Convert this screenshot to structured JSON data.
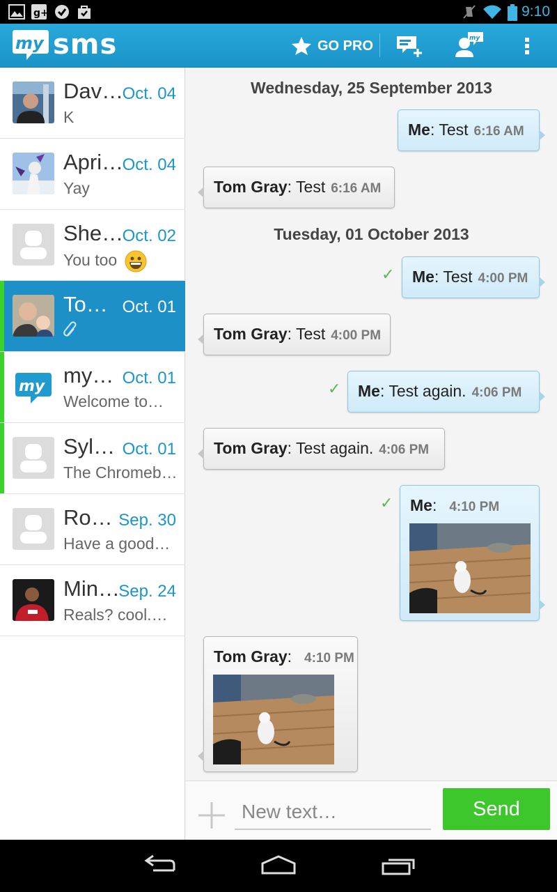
{
  "status_bar": {
    "time": "9:10"
  },
  "action_bar": {
    "logo_text": "sms",
    "logo_bubble_text": "my",
    "go_pro_label": "GO PRO"
  },
  "conversations": [
    {
      "name": "Dav…",
      "date": "Oct. 04",
      "preview": "K",
      "unread": false,
      "active": false
    },
    {
      "name": "Apri…",
      "date": "Oct. 04",
      "preview": "Yay",
      "unread": false,
      "active": false
    },
    {
      "name": "She…",
      "date": "Oct. 02",
      "preview": "You too",
      "unread": false,
      "active": false
    },
    {
      "name": "To…",
      "date": "Oct. 01",
      "preview": "",
      "unread": true,
      "active": true
    },
    {
      "name": "my…",
      "date": "Oct. 01",
      "preview": "Welcome to…",
      "unread": true,
      "active": false
    },
    {
      "name": "Syl…",
      "date": "Oct. 01",
      "preview": "The Chromeb…",
      "unread": true,
      "active": false
    },
    {
      "name": "Ro…",
      "date": "Sep. 30",
      "preview": "Have a good…",
      "unread": false,
      "active": false
    },
    {
      "name": "Min…",
      "date": "Sep. 24",
      "preview": "Reals? cool.…",
      "unread": false,
      "active": false
    }
  ],
  "chat": {
    "days": [
      "Wednesday, 25 September 2013",
      "Tuesday, 01 October 2013"
    ],
    "messages": [
      {
        "sender": "Me",
        "text": "Test",
        "time": "6:16 AM"
      },
      {
        "sender": "Tom Gray",
        "text": "Test",
        "time": "6:16 AM"
      },
      {
        "sender": "Me",
        "text": "Test",
        "time": "4:00 PM"
      },
      {
        "sender": "Tom Gray",
        "text": "Test",
        "time": "4:00 PM"
      },
      {
        "sender": "Me",
        "text": "Test again.",
        "time": "4:06 PM"
      },
      {
        "sender": "Tom Gray",
        "text": "Test again.",
        "time": "4:06 PM"
      },
      {
        "sender": "Me",
        "text": "",
        "time": "4:10 PM"
      },
      {
        "sender": "Tom Gray",
        "text": "",
        "time": "4:10 PM"
      }
    ],
    "separator": ":"
  },
  "composer": {
    "placeholder": "New text…",
    "send_label": "Send"
  }
}
